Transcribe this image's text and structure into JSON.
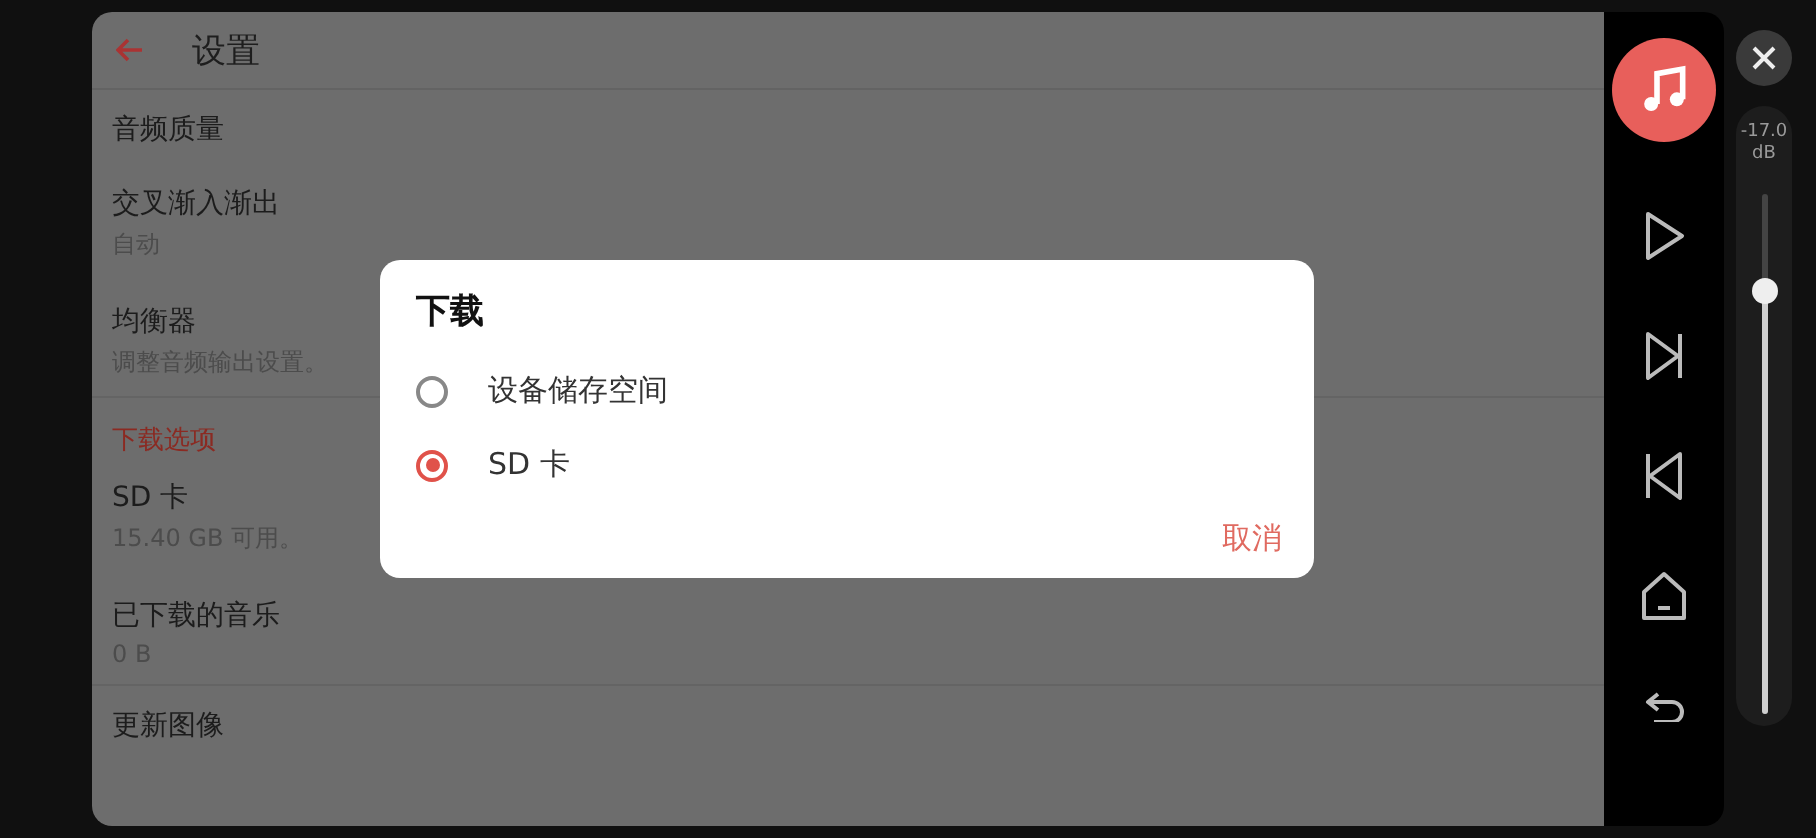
{
  "header": {
    "title": "设置"
  },
  "settings": [
    {
      "kind": "item",
      "title": "音频质量"
    },
    {
      "kind": "item",
      "title": "交叉渐入渐出",
      "subtitle": "自动"
    },
    {
      "kind": "item",
      "title": "均衡器",
      "subtitle": "调整音频输出设置。"
    },
    {
      "kind": "section",
      "title": "下载选项"
    },
    {
      "kind": "item",
      "title": "SD 卡",
      "subtitle": "15.40 GB 可用。"
    },
    {
      "kind": "item",
      "title": "已下载的音乐",
      "subtitle": "0 B"
    },
    {
      "kind": "item",
      "title": "更新图像"
    }
  ],
  "dialog": {
    "title": "下载",
    "options": [
      {
        "label": "设备储存空间",
        "selected": false
      },
      {
        "label": "SD 卡",
        "selected": true
      }
    ],
    "cancel": "取消"
  },
  "volume": {
    "reading": "-17.0\ndB",
    "level": 0.81
  }
}
